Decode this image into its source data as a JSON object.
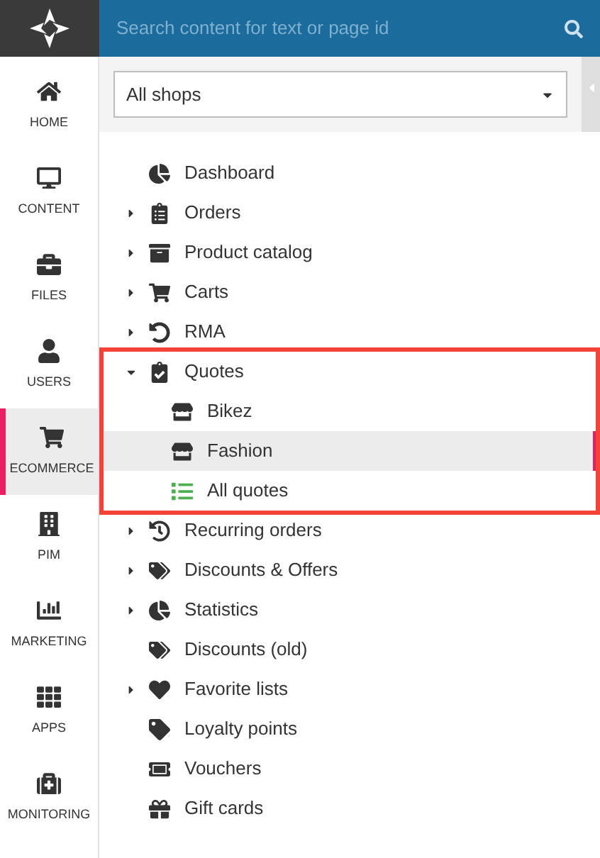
{
  "search": {
    "placeholder": "Search content for text or page id"
  },
  "nav": [
    {
      "label": "HOME",
      "selected": false
    },
    {
      "label": "CONTENT",
      "selected": false
    },
    {
      "label": "FILES",
      "selected": false
    },
    {
      "label": "USERS",
      "selected": false
    },
    {
      "label": "ECOMMERCE",
      "selected": true
    },
    {
      "label": "PIM",
      "selected": false
    },
    {
      "label": "MARKETING",
      "selected": false
    },
    {
      "label": "APPS",
      "selected": false
    },
    {
      "label": "MONITORING",
      "selected": false
    }
  ],
  "shop_select": {
    "value": "All shops"
  },
  "tree": [
    {
      "label": "Dashboard",
      "selected": false
    },
    {
      "label": "Orders",
      "selected": false,
      "expanded": false
    },
    {
      "label": "Product catalog",
      "selected": false,
      "expanded": false
    },
    {
      "label": "Carts",
      "selected": false,
      "expanded": false
    },
    {
      "label": "RMA",
      "selected": false,
      "expanded": false
    },
    {
      "label": "Quotes",
      "selected": false,
      "expanded": true,
      "children": [
        {
          "label": "Bikez",
          "selected": false
        },
        {
          "label": "Fashion",
          "selected": true
        },
        {
          "label": "All quotes",
          "selected": false
        }
      ]
    },
    {
      "label": "Recurring orders",
      "selected": false,
      "expanded": false
    },
    {
      "label": "Discounts & Offers",
      "selected": false,
      "expanded": false
    },
    {
      "label": "Statistics",
      "selected": false,
      "expanded": false
    },
    {
      "label": "Discounts (old)",
      "selected": false
    },
    {
      "label": "Favorite lists",
      "selected": false,
      "expanded": false
    },
    {
      "label": "Loyalty points",
      "selected": false
    },
    {
      "label": "Vouchers",
      "selected": false
    },
    {
      "label": "Gift cards",
      "selected": false
    }
  ]
}
